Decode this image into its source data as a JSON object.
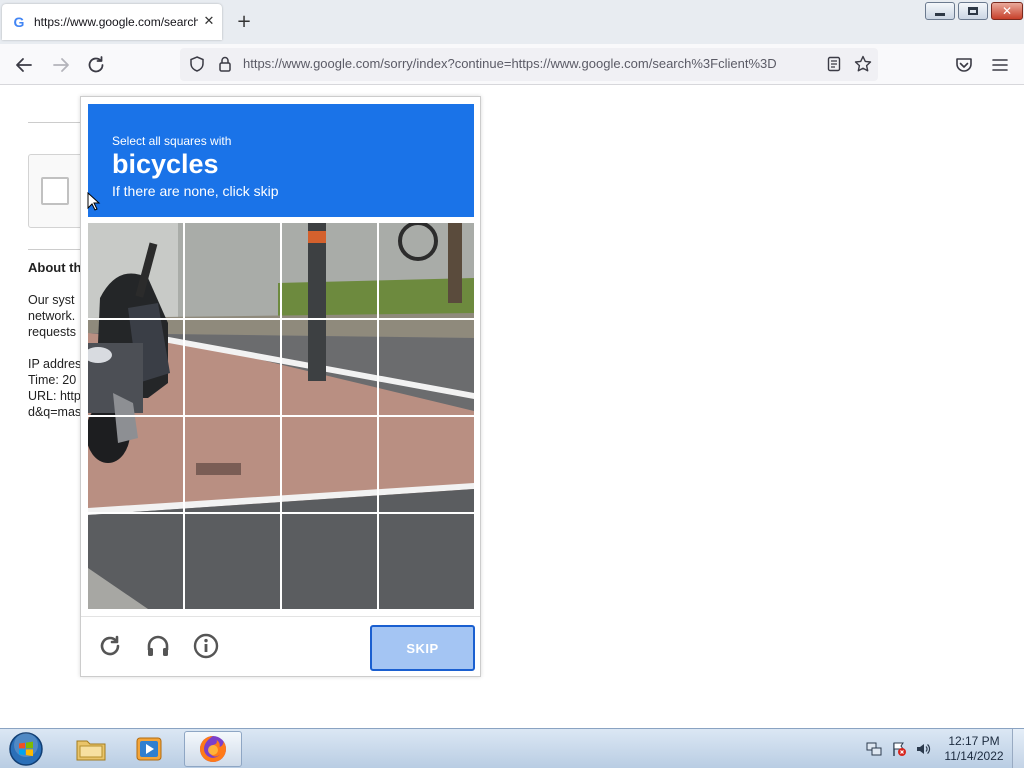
{
  "browser": {
    "tab_title": "https://www.google.com/search?client=firefox-b-d&q=mas",
    "tab_favicon": "G",
    "tab_close_glyph": "✕",
    "new_tab_glyph": "+",
    "url": "https://www.google.com/sorry/index?continue=https://www.google.com/search%3Fclient%3D",
    "url_host": "google.com",
    "icons": [
      "back-icon",
      "forward-icon",
      "reload-icon",
      "tracking-shield-icon",
      "lock-icon",
      "reader-view-icon",
      "bookmark-star-icon",
      "pocket-icon",
      "menu-icon"
    ]
  },
  "page": {
    "about_title": "About th",
    "about_lines": [
      "Our syst",
      "network.",
      "requests"
    ],
    "info_lines": [
      "IP addres",
      "Time: 20",
      "URL: http",
      "d&q=mas"
    ]
  },
  "captcha": {
    "instruction_small": "Select all squares with",
    "instruction_object": "bicycles",
    "instruction_sub": "If there are none, click skip",
    "grid_rows": 4,
    "grid_cols": 4,
    "selected_tiles": [],
    "skip_label": "SKIP",
    "footer_icons": [
      "reload-icon",
      "audio-headphones-icon",
      "info-icon"
    ],
    "header_color": "#1a73e8"
  },
  "taskbar": {
    "time": "12:17 PM",
    "date": "11/14/2022",
    "pinned": [
      "start-orb",
      "file-explorer-icon",
      "media-player-icon",
      "firefox-icon"
    ]
  }
}
